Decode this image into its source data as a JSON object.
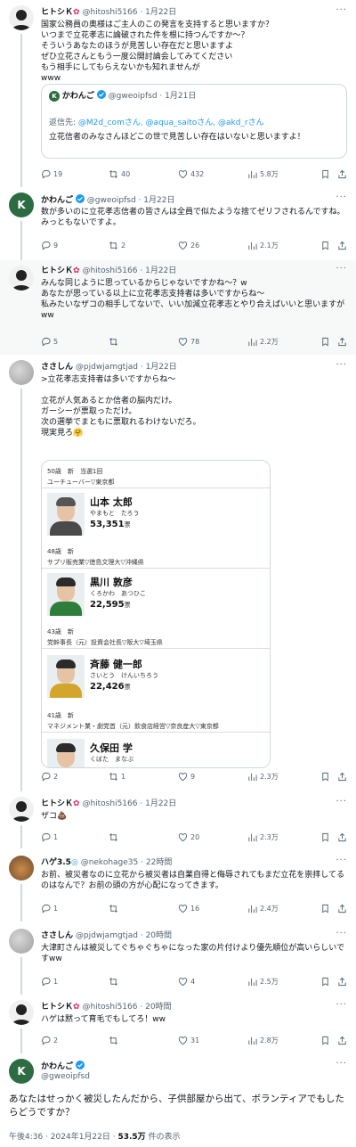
{
  "tweets": [
    {
      "name": "ヒトシＫ",
      "handle": "@hitoshi5166",
      "date": "1月22日",
      "text": "国家公務員の奥様はご主人のこの発言を支持すると思いますか？\nいつまで立花孝志に論破された件を根に持つんですか〜？\nそういうあなたのほうが見苦しい存在だと思いますよ\nぜひ立花さんともう一度公開討論会してみてください\nもう相手にしてもらえないかも知れませんが\nwww",
      "quote": {
        "name": "かわんご",
        "handle": "@gweoipfsd",
        "date": "1月21日",
        "reply_prefix": "返信先: ",
        "reply_users": "@M2d_comさん, @aqua_saitoさん, @akd_rさん",
        "text": "立花信者のみなさんほどこの世で見苦しい存在はいないと思いますよ！"
      },
      "replies": "19",
      "retweets": "40",
      "likes": "432",
      "views": "5.8万"
    },
    {
      "name": "かわんご",
      "handle": "@gweoipfsd",
      "date": "1月22日",
      "text": "数が多いのに立花孝志信者の皆さんは全員で似たような捨てゼリフされるんですね。みっともないですよ。",
      "replies": "9",
      "retweets": "2",
      "likes": "26",
      "views": "2.1万"
    },
    {
      "name": "ヒトシＫ",
      "handle": "@hitoshi5166",
      "date": "1月22日",
      "text": "みんな同じように思っているからじゃないですかね〜？w\nあなたが思っている以上に立花孝志支持者は多いですからね〜\n私みたいなザコの相手してないで、いい加減立花孝志とやり合えばいいと思いますがww",
      "replies": "5",
      "retweets": "",
      "likes": "78",
      "views": "2.2万"
    },
    {
      "name": "ささしん",
      "handle": "@pjdwjamgtjad",
      "date": "1月22日",
      "text": ">立花孝志支持者は多いですからね〜\n\n立花が人気あるとか信者の脳内だけ。\nガーシーが票取っただけ。\n次の選挙でまともに票取れるわけないだろ。\n現実見ろ🤗",
      "replies": "2",
      "retweets": "1",
      "likes": "9",
      "views": "2.3万"
    },
    {
      "name": "ヒトシＫ",
      "handle": "@hitoshi5166",
      "date": "1月22日",
      "text": "ザコ💩",
      "replies": "1",
      "retweets": "",
      "likes": "20",
      "views": "2.3万"
    },
    {
      "name": "ハゲ3.5",
      "handle": "@nekohage35",
      "date": "22時間",
      "text": "お前、被災者なのに立花から被災者は自業自得と侮辱されてもまだ立花を崇拝してるのはなんで？お前の頭の方が心配になってきます。",
      "replies": "1",
      "retweets": "",
      "likes": "16",
      "views": "2.4万"
    },
    {
      "name": "ささしん",
      "handle": "@pjdwjamgtjad",
      "date": "20時間",
      "text": "大津町さんは被災してぐちゃぐちゃになった家の片付けより優先順位が高いらしいですww",
      "replies": "1",
      "retweets": "",
      "likes": "4",
      "views": "2.5万"
    },
    {
      "name": "ヒトシＫ",
      "handle": "@hitoshi5166",
      "date": "20時間",
      "text": "ハゲは黙って育毛でもしてろ！ww",
      "replies": "2",
      "retweets": "",
      "likes": "31",
      "views": "2.8万"
    }
  ],
  "candidates": [
    {
      "age_line": "50歳　新　当選1回",
      "job": "ユーチューバー▽東京都",
      "name": "山本 太郎",
      "kana": "やまもと　たろう",
      "votes": "53,351",
      "unit": "票"
    },
    {
      "age_line": "48歳　新",
      "job": "サプリ販売業▽徳島文理大▽沖縄県",
      "name": "黒川 敦彦",
      "kana": "くろかわ　あつひこ",
      "votes": "22,595",
      "unit": "票"
    },
    {
      "age_line": "43歳　新",
      "job": "党幹事長（元）投資会社長▽阪大▽埼玉県",
      "name": "斉藤 健一郎",
      "kana": "さいとう　けんいちろう",
      "votes": "22,426",
      "unit": "票"
    },
    {
      "age_line": "41歳　新",
      "job": "マネジメント業・劇党首（元）飲食店経営▽奈良産大▽東京都",
      "name": "久保田 学",
      "kana": "くぼた　まなぶ",
      "votes": "",
      "unit": ""
    }
  ],
  "main_tweet": {
    "name": "かわんご",
    "handle": "@gweoipfsd",
    "text": "あなたはせっかく被災したんだから、子供部屋から出て、ボランティアでもしたらどうですか？",
    "time": "午後4:36 · 2024年1月22日 · ",
    "views_count": "53.5万",
    "views_label": " 件の表示"
  },
  "colors": {
    "accent": "#1d9bf0",
    "text": "#0f1419",
    "muted": "#536471"
  }
}
